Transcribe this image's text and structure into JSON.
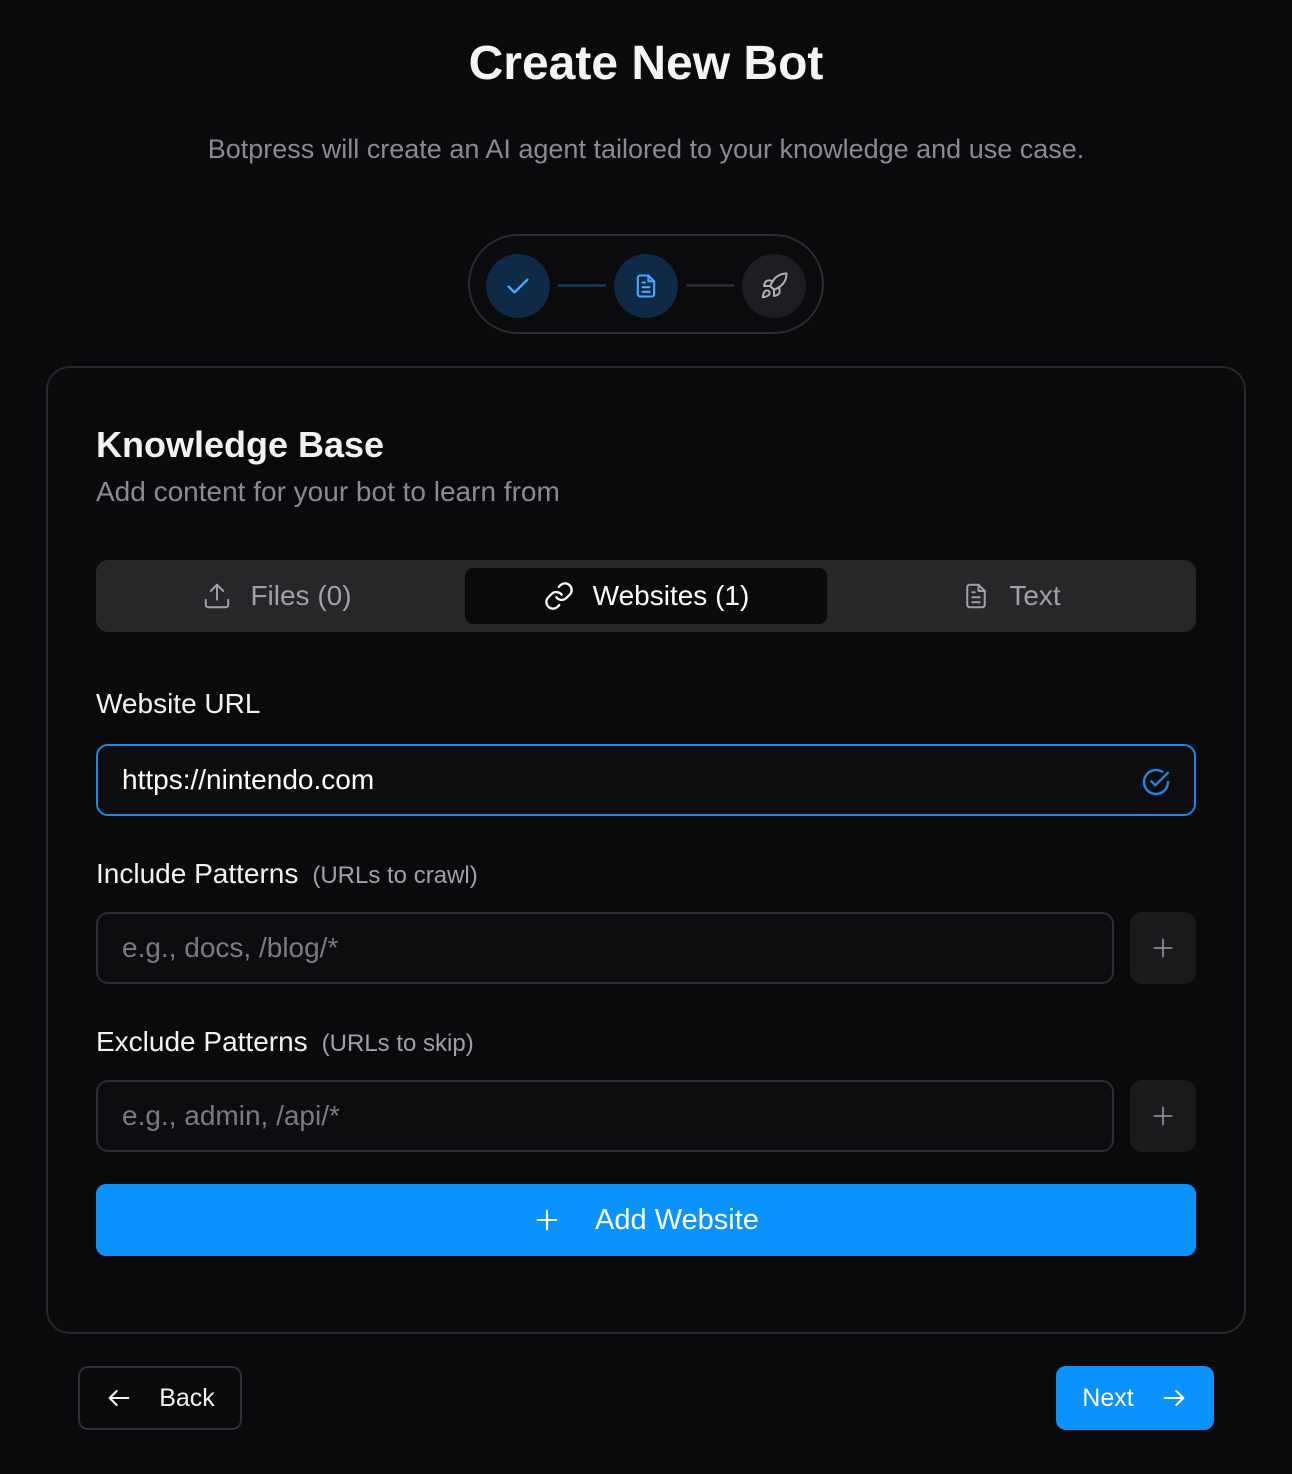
{
  "header": {
    "title": "Create New Bot",
    "subtitle": "Botpress will create an AI agent tailored to your knowledge and use case."
  },
  "stepper": {
    "steps": [
      {
        "icon": "check-icon",
        "state": "complete"
      },
      {
        "icon": "document-icon",
        "state": "active"
      },
      {
        "icon": "rocket-icon",
        "state": "upcoming"
      }
    ]
  },
  "card": {
    "title": "Knowledge Base",
    "subtitle": "Add content for your bot to learn from",
    "tabs": [
      {
        "label": "Files (0)",
        "icon": "upload-icon"
      },
      {
        "label": "Websites (1)",
        "icon": "link-icon",
        "selected": true
      },
      {
        "label": "Text",
        "icon": "document-icon"
      }
    ],
    "website_url": {
      "label": "Website URL",
      "value": "https://nintendo.com"
    },
    "include": {
      "label": "Include Patterns",
      "hint": "(URLs to crawl)",
      "placeholder": "e.g., docs, /blog/*"
    },
    "exclude": {
      "label": "Exclude Patterns",
      "hint": "(URLs to skip)",
      "placeholder": "e.g., admin, /api/*"
    },
    "add_website_label": "Add Website"
  },
  "footer": {
    "back_label": "Back",
    "next_label": "Next"
  },
  "colors": {
    "accent": "#0a92ff",
    "background": "#0a0a0c",
    "focus_border": "#1e88e5"
  }
}
